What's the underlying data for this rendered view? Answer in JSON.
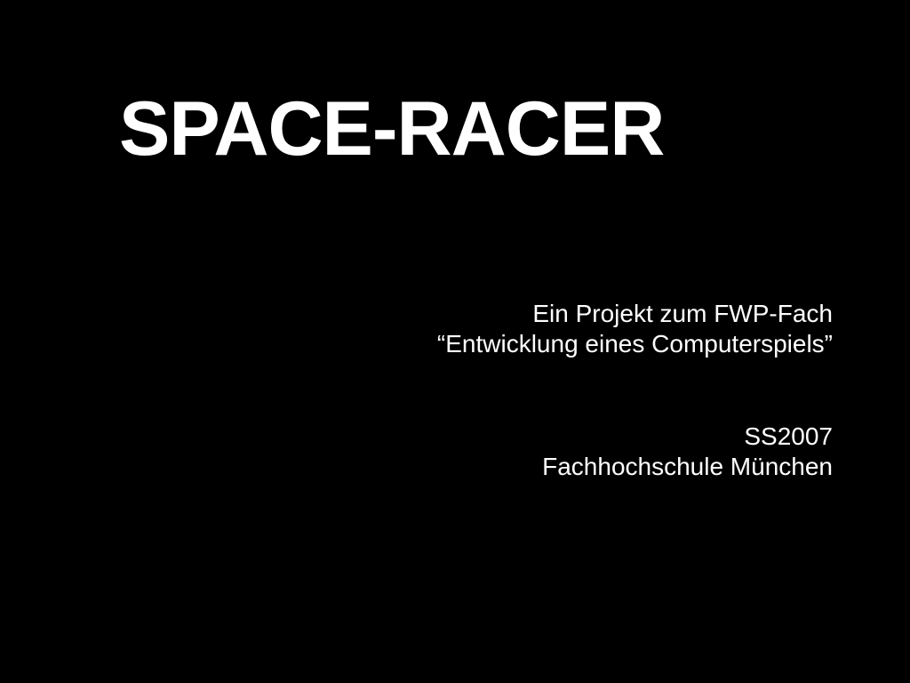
{
  "title": "SPACE-RACER",
  "project": {
    "line1": "Ein Projekt zum FWP-Fach",
    "line2": "“Entwicklung eines Computerspiels”"
  },
  "term": {
    "semester": "SS2007",
    "institution": "Fachhochschule München"
  },
  "colors": {
    "background": "#000000",
    "text": "#ffffff"
  }
}
